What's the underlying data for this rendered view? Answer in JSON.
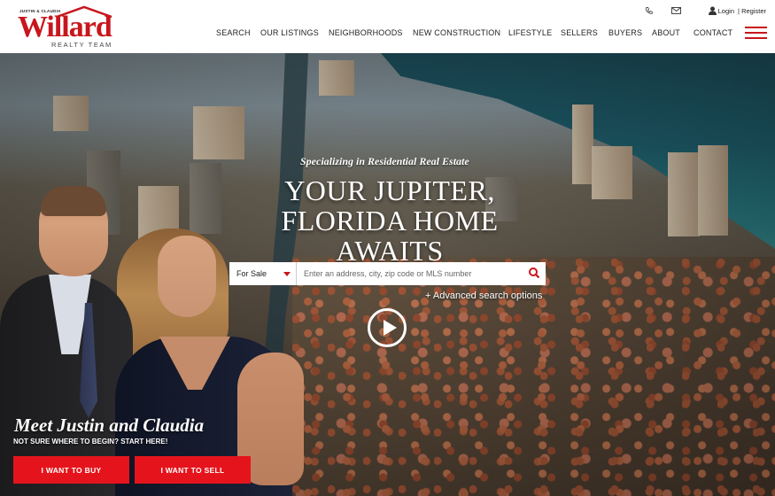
{
  "brand": {
    "pretitle": "JUSTIN & CLAUDIA",
    "name": "Willard",
    "subtitle": "REALTY TEAM",
    "accent_color": "#c8161d"
  },
  "utility": {
    "phone_icon": "phone-icon",
    "mail_icon": "mail-icon",
    "user_icon": "user-icon",
    "login_label": "Login",
    "separator": "|",
    "register_label": "Register"
  },
  "nav": {
    "items": [
      {
        "label": "SEARCH"
      },
      {
        "label": "OUR LISTINGS"
      },
      {
        "label": "NEIGHBORHOODS"
      },
      {
        "label": "NEW CONSTRUCTION"
      },
      {
        "label": "LIFESTYLE"
      },
      {
        "label": "SELLERS"
      },
      {
        "label": "BUYERS"
      },
      {
        "label": "ABOUT"
      },
      {
        "label": "CONTACT"
      }
    ],
    "menu_icon": "hamburger-icon"
  },
  "hero": {
    "tagline": "Specializing in Residential Real Estate",
    "headline": "YOUR JUPITER, FLORIDA HOME AWAITS",
    "search": {
      "type_selected": "For Sale",
      "placeholder": "Enter an address, city, zip code or MLS number",
      "value": ""
    },
    "advanced_link": "+ Advanced search options",
    "play_icon": "play-icon"
  },
  "intro": {
    "title": "Meet Justin and Claudia",
    "subtitle": "NOT SURE WHERE TO BEGIN? START HERE!",
    "buy_button": "I WANT TO BUY",
    "sell_button": "I WANT TO SELL",
    "button_color": "#e5141c"
  }
}
